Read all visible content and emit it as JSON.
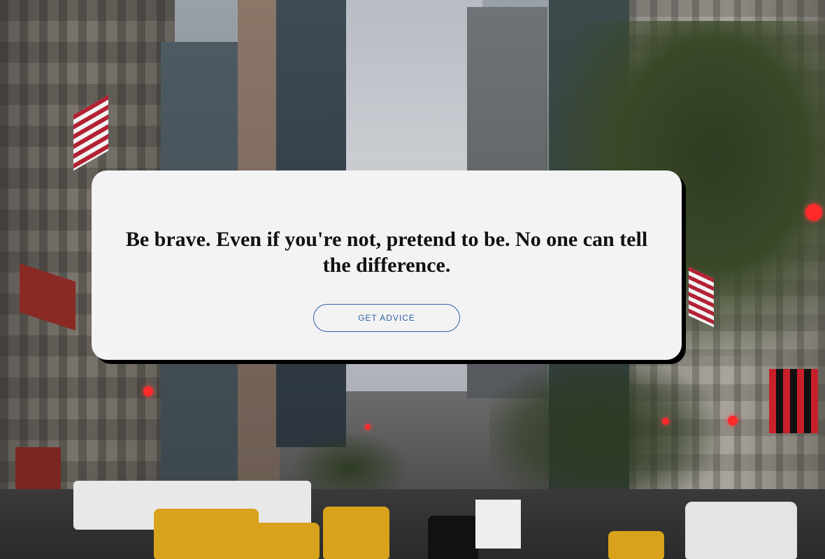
{
  "background": {
    "scene": "city-street-icon"
  },
  "card": {
    "quote": "Be brave. Even if you're not, pretend to be. No one can tell the difference.",
    "button_label": "GET ADVICE"
  },
  "colors": {
    "card_background": "#f3f3f4",
    "button_accent": "#2b5fa3",
    "quote_text": "#111111"
  }
}
